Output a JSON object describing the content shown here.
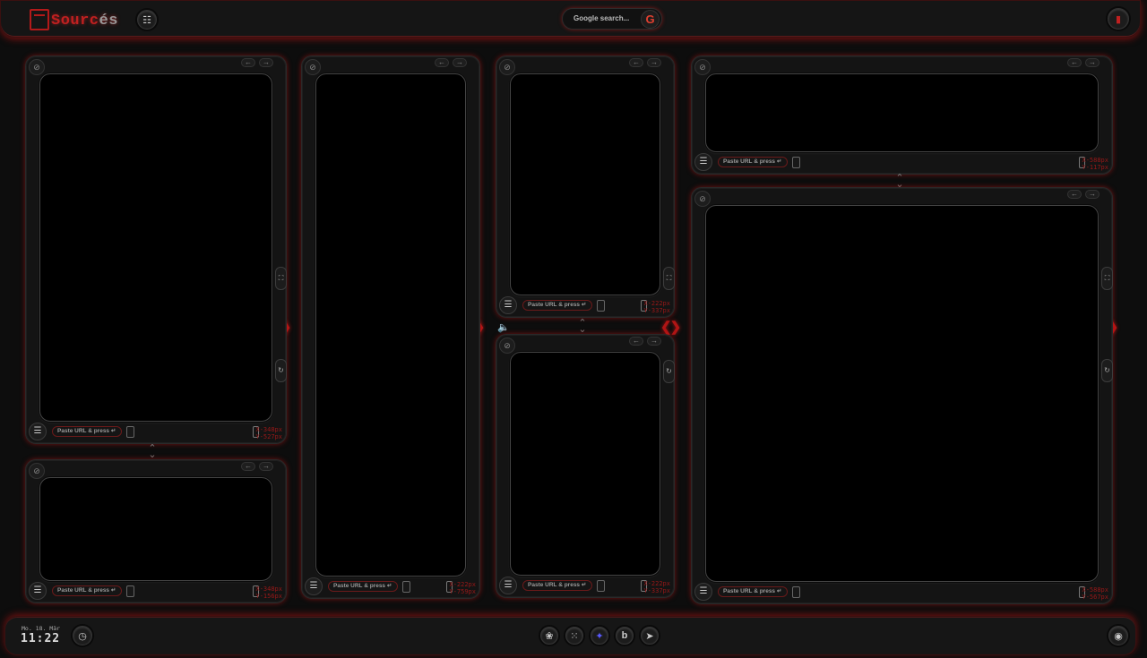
{
  "header": {
    "logo_text": "Sourc",
    "logo_suffix": "és",
    "sitemap_icon": "sitemap-icon",
    "search_placeholder": "Google search...",
    "search_button": "G",
    "bookmark_icon": "bookmark-icon"
  },
  "panels": [
    {
      "id": "p1",
      "url_label": "Paste URL & press ↵",
      "size_x": "X-348px",
      "size_y": "Y-527px"
    },
    {
      "id": "p2",
      "url_label": "Paste URL & press ↵",
      "size_x": "X-348px",
      "size_y": "Y-156px"
    },
    {
      "id": "p3",
      "url_label": "Paste URL & press ↵",
      "size_x": "X-222px",
      "size_y": "Y-759px"
    },
    {
      "id": "p4",
      "url_label": "Paste URL & press ↵",
      "size_x": "X-222px",
      "size_y": "Y-337px"
    },
    {
      "id": "p5",
      "url_label": "Paste URL & press ↵",
      "size_x": "X-222px",
      "size_y": "Y-337px"
    },
    {
      "id": "p6",
      "url_label": "Paste URL & press ↵",
      "size_x": "X-588px",
      "size_y": "Y-117px"
    },
    {
      "id": "p7",
      "url_label": "Paste URL & press ↵",
      "size_x": "X-588px",
      "size_y": "Y-567px"
    }
  ],
  "footer": {
    "date": "Mo. 18. Mär",
    "time": "11:22",
    "dock": [
      "openai-icon",
      "grid-dots-icon",
      "sparkle-icon",
      "bing-icon",
      "share-icon"
    ],
    "dock_glyphs": [
      "❀",
      "⁙",
      "✦",
      "b",
      "➤"
    ],
    "github_icon": "github-icon"
  },
  "colors": {
    "accent": "#c02020",
    "background": "#0d0d0d",
    "panel": "#141414"
  }
}
